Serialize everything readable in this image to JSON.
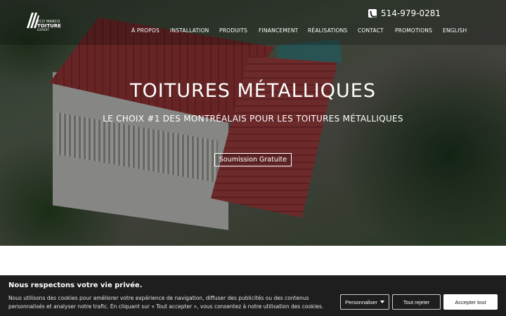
{
  "header": {
    "logo": {
      "line1": "ECO MARCO",
      "line2": "TOITURE",
      "line3": "EXPERT"
    },
    "phone": "514-979-0281",
    "nav": [
      "À PROPOS",
      "INSTALLATION",
      "PRODUITS",
      "FINANCEMENT",
      "RÉALISATIONS",
      "CONTACT",
      "PROMOTIONS",
      "ENGLISH"
    ]
  },
  "hero": {
    "title": "TOITURES MÉTALLIQUES",
    "subtitle": "LE CHOIX #1 DES MONTRÉALAIS POUR LES TOITURES MÉTALLIQUES",
    "cta_label": "Soumission Gratuite"
  },
  "cookie_banner": {
    "title": "Nous respectons votre vie privée.",
    "text": "Nous utilisons des cookies pour améliorer votre expérience de navigation, diffuser des publicités ou des contenus personnalisés et analyser notre trafic. En cliquant sur « Tout accepter », vous consentez à notre utilisation des cookies.",
    "customize_label": "Personnaliser",
    "reject_label": "Tout rejeter",
    "accept_label": "Accepter tout"
  },
  "icons": {
    "phone": "phone-icon",
    "logo": "logo-mark-icon",
    "dropdown": "chevron-down-icon"
  },
  "colors": {
    "roof": "#a53a3c",
    "cookie_bg": "#1e1e1e",
    "accept_bg": "#ffffff"
  }
}
